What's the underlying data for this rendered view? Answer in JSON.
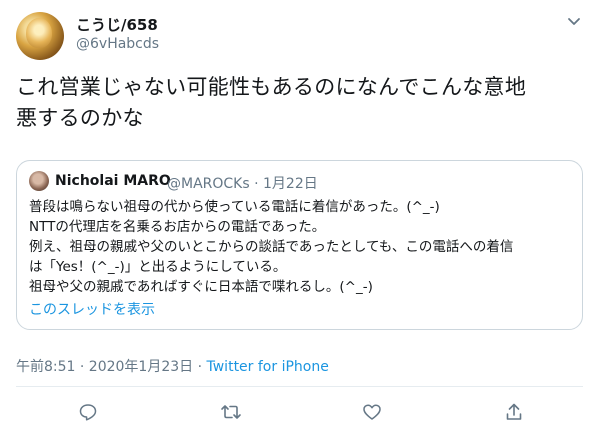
{
  "author": {
    "display_name": "こうじ/658",
    "handle": "@6vHabcds"
  },
  "tweet": {
    "line1": "これ営業じゃない可能性もあるのになんでこんな意地",
    "line2": "悪するのかな"
  },
  "quoted": {
    "display_name": "Nicholai MARO",
    "handle_date": "@MAROCKs · 1月22日",
    "lines": [
      "普段は鳴らない祖母の代から使っている電話に着信があった。(^_-)",
      "NTTの代理店を名乗るお店からの電話であった。",
      "例え、祖母の親戚や父のいとこからの談話であったとしても、この電話への着信",
      "は「Yes！(^_-)」と出るようにしている。",
      "祖母や父の親戚であればすぐに日本語で喋れるし。(^_-)"
    ],
    "thread_link": "このスレッドを表示"
  },
  "meta": {
    "timestamp": "午前8:51 · 2020年1月23日 · ",
    "source": "Twitter for iPhone"
  },
  "icons": {
    "caret": "chevron-down-icon",
    "reply": "reply-icon",
    "retweet": "retweet-icon",
    "like": "like-icon",
    "share": "share-icon"
  },
  "colors": {
    "text": "#14171a",
    "secondary": "#657786",
    "link": "#1b95e0",
    "border": "#ccd6dd"
  }
}
